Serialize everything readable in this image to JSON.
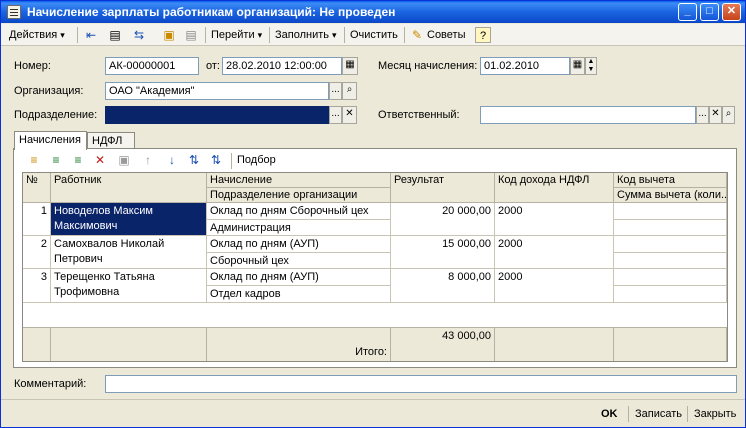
{
  "window": {
    "title": "Начисление зарплаты работникам организаций: Не проведен",
    "min": "_",
    "max": "□",
    "close": "✕"
  },
  "toolbar": {
    "actions": "Действия",
    "goto": "Перейти",
    "fill": "Заполнить",
    "clear": "Очистить",
    "tips": "Советы",
    "help": "?"
  },
  "form": {
    "number_label": "Номер:",
    "number_value": "АК-00000001",
    "from_label": "от:",
    "date_value": "28.02.2010 12:00:00",
    "month_label": "Месяц начисления:",
    "month_value": "01.02.2010",
    "org_label": "Организация:",
    "org_value": "ОАО \"Академия\"",
    "dept_label": "Подразделение:",
    "dept_value": "",
    "resp_label": "Ответственный:",
    "resp_value": "",
    "comment_label": "Комментарий:",
    "comment_value": ""
  },
  "tabs": [
    "Начисления",
    "НДФЛ"
  ],
  "subtoolbar": {
    "pick": "Подбор"
  },
  "table": {
    "headers": {
      "num": "№",
      "employee": "Работник",
      "accrual": "Начисление",
      "dept": "Подразделение организации",
      "result": "Результат",
      "income_code": "Код дохода НДФЛ",
      "deduction_code": "Код вычета",
      "deduction_sum": "Сумма вычета (коли..."
    },
    "rows": [
      {
        "num": "1",
        "employee": "Новоделов Максим Максимович",
        "accrual": "Оклад по дням Сборочный цех",
        "dept": "Администрация",
        "result": "20 000,00",
        "income_code": "2000"
      },
      {
        "num": "2",
        "employee": "Самохвалов Николай Петрович",
        "accrual": "Оклад по дням (АУП)",
        "dept": "Сборочный цех",
        "result": "15 000,00",
        "income_code": "2000"
      },
      {
        "num": "3",
        "employee": "Терещенко Татьяна Трофимовна",
        "accrual": "Оклад по дням (АУП)",
        "dept": "Отдел кадров",
        "result": "8 000,00",
        "income_code": "2000"
      }
    ],
    "total_value": "43 000,00",
    "total_label": "Итого:"
  },
  "bottom": {
    "ok": "OK",
    "save": "Записать",
    "close": "Закрыть"
  },
  "colors": {
    "title_bar": "#0a5fe8",
    "selection": "#0a246a",
    "face": "#ece9d8"
  }
}
